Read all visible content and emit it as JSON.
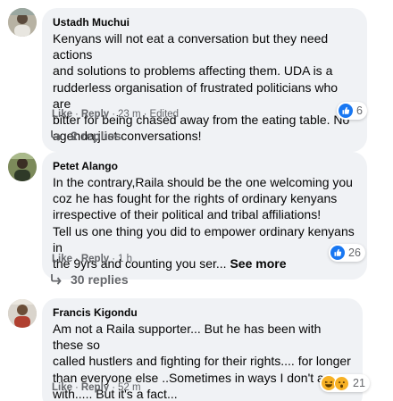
{
  "comments": [
    {
      "author": "Ustadh Muchui",
      "lines": [
        "Kenyans will not eat a conversation but they need actions",
        "and solutions to problems affecting them. UDA is a",
        "rudderless organisation of frustrated politicians who are",
        "bitter for being chased away from the eating table. No",
        "agenda,just conversations!"
      ],
      "like_label": "Like",
      "reply_label": "Reply",
      "time": "23 m",
      "edited": "Edited",
      "reaction_count": "6",
      "reactions": [
        "like-icon"
      ],
      "replies_label": "2 replies"
    },
    {
      "author": "Petet Alango",
      "lines": [
        "In the contrary,Raila should be the one welcoming you",
        "coz he has fought for the rights of ordinary kenyans",
        "irrespective of their political and tribal affiliations!",
        "Tell us one thing you did to empower ordinary kenyans in",
        "the 9yrs and counting you ser..."
      ],
      "see_more": "See more",
      "like_label": "Like",
      "reply_label": "Reply",
      "time": "1 h",
      "reaction_count": "26",
      "reactions": [
        "like-icon"
      ],
      "replies_label": "30 replies"
    },
    {
      "author": "Francis Kigondu",
      "lines": [
        "Am not a Raila supporter... But he has been with these so",
        "called hustlers and fighting for their rights.... for longer",
        "than everyone else ..Sometimes in ways I don't agree",
        "with..... But it's a fact..."
      ],
      "like_label": "Like",
      "reply_label": "Reply",
      "time": "52 m",
      "reaction_count": "21",
      "reactions": [
        "haha-icon",
        "wow-icon"
      ]
    }
  ],
  "colors": {
    "bubble": "#f0f2f5",
    "meta": "#65676b",
    "like_blue": "#1877f2",
    "emoji_yellow": "#f7b125"
  }
}
